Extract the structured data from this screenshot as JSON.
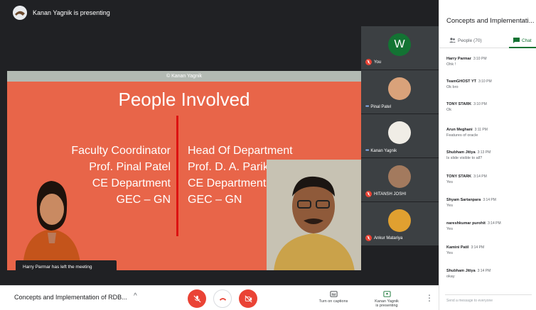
{
  "presenting": {
    "text": "Kanan Yagnik is presenting"
  },
  "slide": {
    "watermark": "© Kanan Yagnik",
    "title": "People Involved",
    "left": [
      "Faculty Coordinator",
      "Prof. Pinal Patel",
      "CE Department",
      "GEC – GN"
    ],
    "right": [
      "Head Of Department",
      "Prof. D. A. Parikh",
      "CE Department",
      "GEC – GN"
    ],
    "colors": {
      "background": "#e86549",
      "divider": "#dd1111"
    }
  },
  "toast": "Harry Parmar has left the meeting",
  "participants": [
    {
      "name": "You",
      "avatar_letter": "W",
      "muted": true
    },
    {
      "name": "Pinal Patel",
      "muted": false
    },
    {
      "name": "Kanan Yagnik",
      "muted": false
    },
    {
      "name": "HITANSH JOSHI",
      "muted": true
    },
    {
      "name": "Ankur Matariya",
      "muted": true
    }
  ],
  "bottom_bar": {
    "meeting_title": "Concepts and Implementation of RDB...",
    "captions_label": "Turn on captions",
    "presenting_label_1": "Kanan Yagnik",
    "presenting_label_2": "is presenting"
  },
  "side_panel": {
    "title": "Concepts and Implementati...",
    "people_tab": "People (70)",
    "chat_tab": "Chat",
    "input_placeholder": "Send a message to everyone",
    "messages": [
      {
        "sender": "Harry Parmar",
        "time": "3:10 PM",
        "text": "Ohk !"
      },
      {
        "sender": "TeamGHOST YT",
        "time": "3:10 PM",
        "text": "Ok bro"
      },
      {
        "sender": "TONY STARK",
        "time": "3:10 PM",
        "text": "Ok"
      },
      {
        "sender": "Arun Meghani",
        "time": "3:11 PM",
        "text": "Features of oracle"
      },
      {
        "sender": "Shubham Jitiya",
        "time": "3:13 PM",
        "text": "Is slide visible to all?"
      },
      {
        "sender": "TONY STARK",
        "time": "3:14 PM",
        "text": "Yes"
      },
      {
        "sender": "Shyam Sartanpara",
        "time": "3:14 PM",
        "text": "Yes"
      },
      {
        "sender": "nareshkumar purohit",
        "time": "3:14 PM",
        "text": "Yes"
      },
      {
        "sender": "Kamini Patil",
        "time": "3:14 PM",
        "text": "Yes"
      },
      {
        "sender": "Shubham Jitiya",
        "time": "3:14 PM",
        "text": "okay"
      }
    ]
  }
}
